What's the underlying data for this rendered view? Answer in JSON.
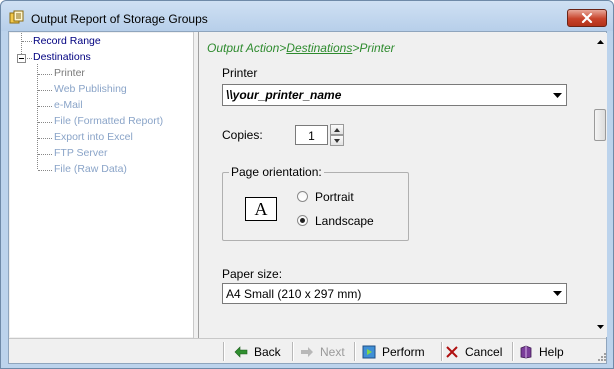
{
  "window": {
    "title": "Output Report of Storage Groups"
  },
  "tree": {
    "items": [
      {
        "label": "Record Range"
      },
      {
        "label": "Destinations"
      },
      {
        "label": "Printer"
      },
      {
        "label": "Web Publishing"
      },
      {
        "label": "e-Mail"
      },
      {
        "label": "File (Formatted Report)"
      },
      {
        "label": "Export into Excel"
      },
      {
        "label": "FTP Server"
      },
      {
        "label": "File (Raw Data)"
      }
    ]
  },
  "breadcrumb": {
    "prefix": "Output Action>",
    "link": "Destinations",
    "suffix": ">Printer"
  },
  "printer": {
    "label": "Printer",
    "value": "\\\\your_printer_name"
  },
  "copies": {
    "label": "Copies:",
    "value": "1"
  },
  "orientation": {
    "legend": "Page orientation:",
    "icon_glyph": "A",
    "options": [
      "Portrait",
      "Landscape"
    ],
    "selected": "Landscape"
  },
  "paper": {
    "label": "Paper size:",
    "value": "A4 Small (210 x 297 mm)"
  },
  "buttons": {
    "back": "Back",
    "next": "Next",
    "perform": "Perform",
    "cancel": "Cancel",
    "help": "Help"
  },
  "colors": {
    "breadcrumb": "#2e8b2e",
    "tree_top": "#000080",
    "tree_sub": "#8aa4c8",
    "close_button": "#c8432b"
  }
}
